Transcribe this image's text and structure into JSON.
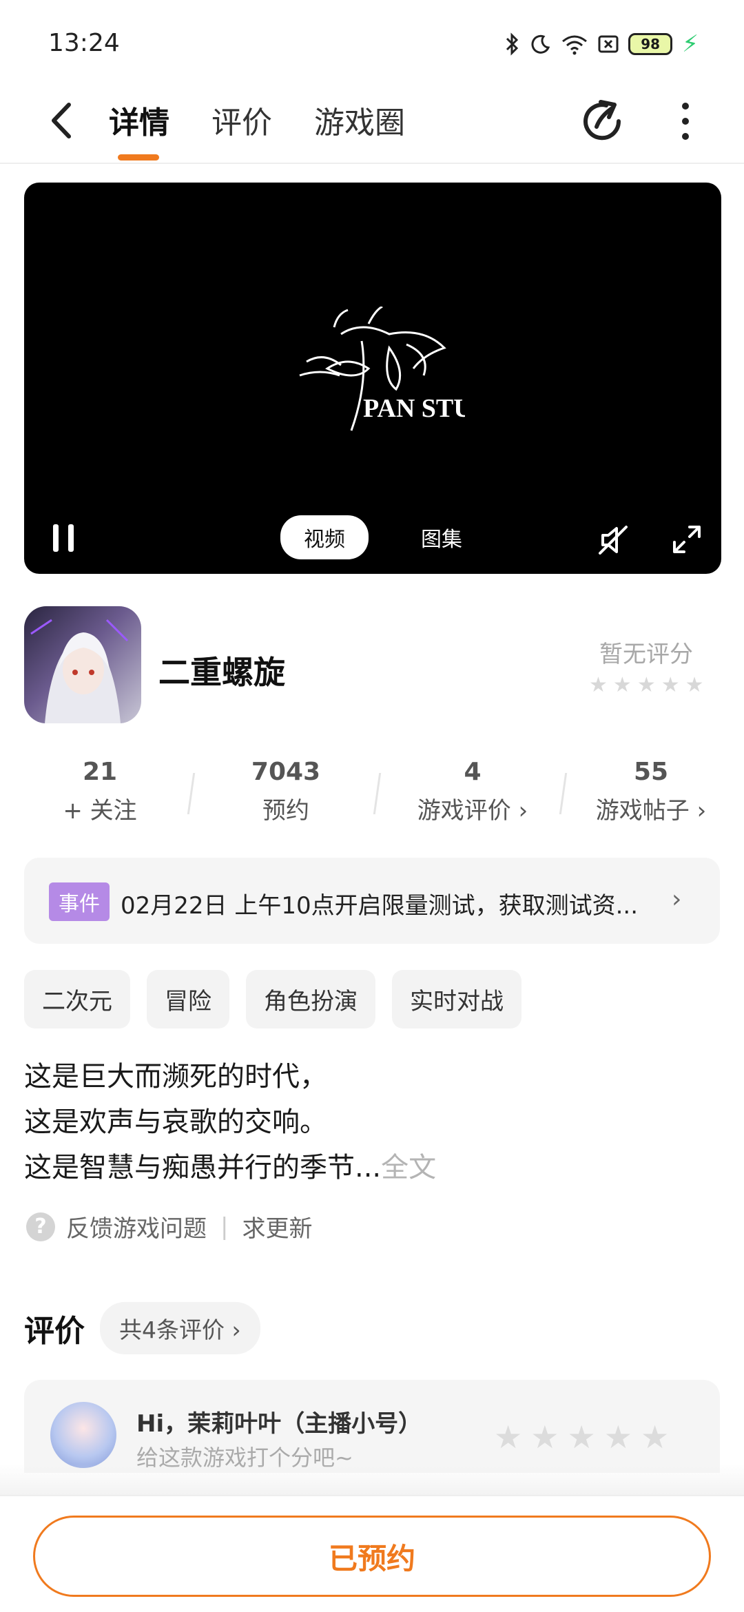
{
  "status_bar": {
    "time": "13:24",
    "battery": "98",
    "icons": [
      "bluetooth-icon",
      "moon-icon",
      "wifi-icon",
      "sim-icon",
      "battery-icon",
      "charging-icon"
    ]
  },
  "nav": {
    "tabs": [
      {
        "label": "详情",
        "active": true
      },
      {
        "label": "评价",
        "active": false
      },
      {
        "label": "游戏圈",
        "active": false
      }
    ],
    "accent_color": "#f07a1e"
  },
  "media": {
    "tabs": [
      {
        "label": "视频",
        "active": true
      },
      {
        "label": "图集",
        "active": false
      }
    ],
    "logo_text": "PAN STUDIO"
  },
  "game": {
    "title": "二重螺旋",
    "rating_text": "暂无评分",
    "rating_stars": 0
  },
  "stats": [
    {
      "value": "21",
      "label": "+ 关注"
    },
    {
      "value": "7043",
      "label": "预约"
    },
    {
      "value": "4",
      "label": "游戏评价 ›"
    },
    {
      "value": "55",
      "label": "游戏帖子 ›"
    }
  ],
  "event": {
    "badge": "事件",
    "text": "02月22日  上午10点开启限量测试，获取测试资...",
    "badge_color": "#b58ae6"
  },
  "tags": [
    "二次元",
    "冒险",
    "角色扮演",
    "实时对战"
  ],
  "description": {
    "lines": [
      "这是巨大而濒死的时代，",
      "这是欢声与哀歌的交响。",
      "这是智慧与痴愚并行的季节..."
    ],
    "more_label": "全文"
  },
  "feedback": {
    "report_label": "反馈游戏问题",
    "request_label": "求更新"
  },
  "reviews": {
    "heading": "评价",
    "count_label": "共4条评价 ›",
    "user_greeting": "Hi，茉莉叶叶（主播小号）",
    "prompt": "给这款游戏打个分吧~"
  },
  "bottom": {
    "reserve_label": "已预约"
  }
}
